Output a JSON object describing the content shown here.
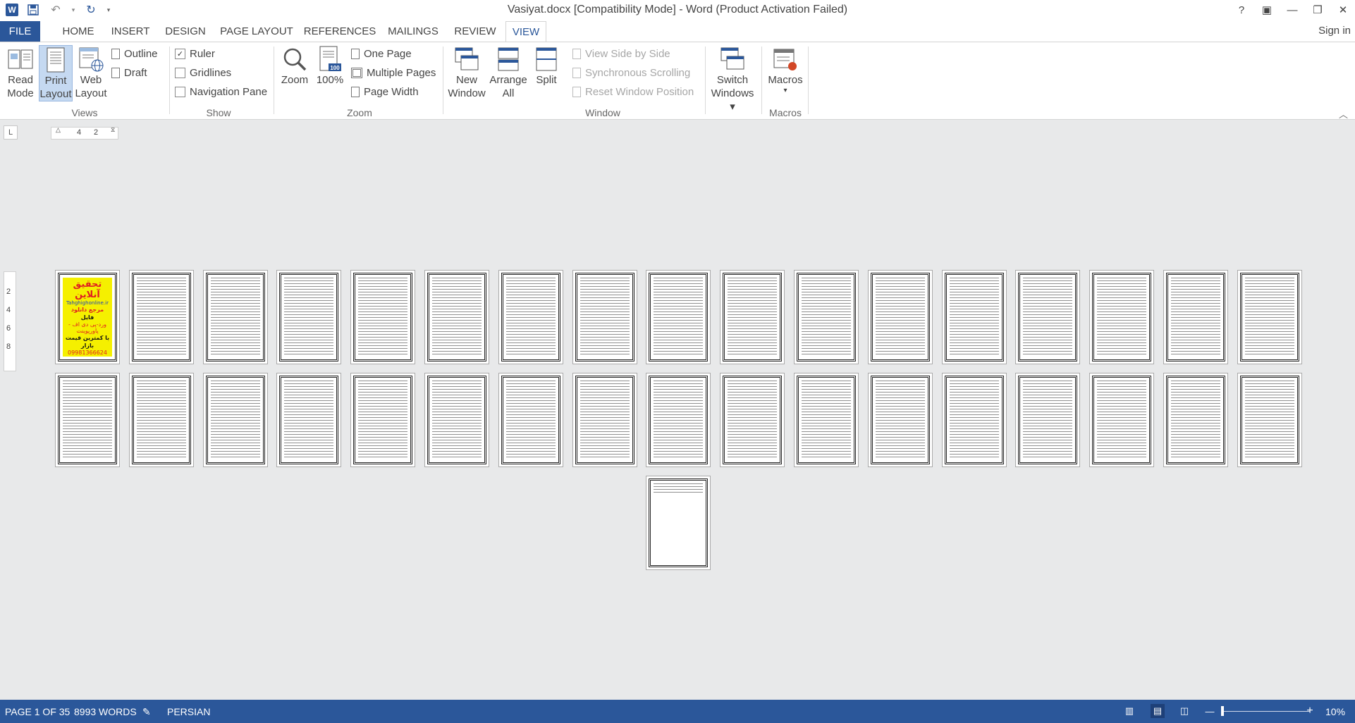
{
  "window": {
    "title": "Vasiyat.docx [Compatibility Mode] - Word (Product Activation Failed)",
    "controls": [
      "?",
      "▣",
      "—",
      "❐",
      "✕"
    ]
  },
  "qat": {
    "app_icon": "W",
    "save_icon": "save-icon",
    "undo_icon": "undo-icon",
    "redo_icon": "redo-icon",
    "customize": "▾"
  },
  "tabs": [
    {
      "label": "FILE"
    },
    {
      "label": "HOME"
    },
    {
      "label": "INSERT"
    },
    {
      "label": "DESIGN"
    },
    {
      "label": "PAGE LAYOUT"
    },
    {
      "label": "REFERENCES"
    },
    {
      "label": "MAILINGS"
    },
    {
      "label": "REVIEW"
    },
    {
      "label": "VIEW"
    }
  ],
  "active_tab": "VIEW",
  "signin": "Sign in",
  "ribbon": {
    "views": {
      "label": "Views",
      "read_mode": [
        "Read",
        "Mode"
      ],
      "print_layout": [
        "Print",
        "Layout"
      ],
      "web_layout": [
        "Web",
        "Layout"
      ],
      "outline": "Outline",
      "draft": "Draft"
    },
    "show": {
      "label": "Show",
      "ruler": "Ruler",
      "ruler_checked": true,
      "gridlines": "Gridlines",
      "gridlines_checked": false,
      "nav_pane": "Navigation Pane",
      "nav_pane_checked": false
    },
    "zoom": {
      "label": "Zoom",
      "zoom": "Zoom",
      "hundred": "100%",
      "hundred_badge": "100",
      "one_page": "One Page",
      "multiple_pages": "Multiple Pages",
      "page_width": "Page Width"
    },
    "window": {
      "label": "Window",
      "new_window": [
        "New",
        "Window"
      ],
      "arrange_all": [
        "Arrange",
        "All"
      ],
      "split": "Split",
      "view_side": "View Side by Side",
      "sync_scroll": "Synchronous Scrolling",
      "reset_pos": "Reset Window Position",
      "switch_windows": [
        "Switch",
        "Windows ▾"
      ]
    },
    "macros": {
      "label": "Macros",
      "macros": "Macros",
      "dropdown": "▾"
    }
  },
  "ruler": {
    "corner": "L",
    "h_ticks": [
      "4",
      "2"
    ],
    "v_ticks": [
      "2",
      "4",
      "6",
      "8"
    ]
  },
  "cover_page": {
    "line1": "تحقیق آنلاین",
    "line2": "Tahghighonline.ir",
    "line3": "مرجع دانلود",
    "line4": "فایل",
    "line5": "ورد-پی دی اف - پاورپوینت",
    "line6": "با کمترین قیمت بازار",
    "line7": "09981366624 واتساپ"
  },
  "document": {
    "total_pages": 35
  },
  "status": {
    "page": "PAGE 1 OF 35",
    "words": "8993 WORDS",
    "language": "PERSIAN",
    "zoom": "10%",
    "zoom_percent": 10
  }
}
